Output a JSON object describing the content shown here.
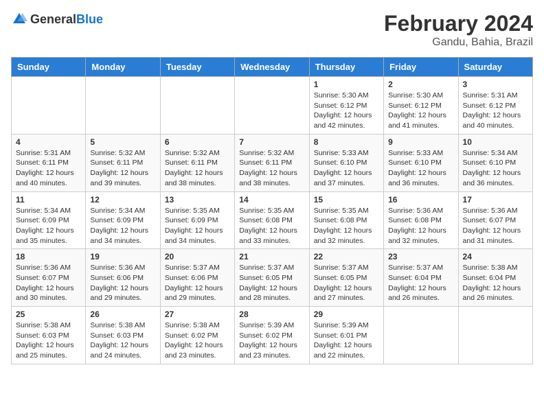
{
  "header": {
    "logo_general": "General",
    "logo_blue": "Blue",
    "title": "February 2024",
    "location": "Gandu, Bahia, Brazil"
  },
  "weekdays": [
    "Sunday",
    "Monday",
    "Tuesday",
    "Wednesday",
    "Thursday",
    "Friday",
    "Saturday"
  ],
  "weeks": [
    [
      {
        "day": "",
        "info": ""
      },
      {
        "day": "",
        "info": ""
      },
      {
        "day": "",
        "info": ""
      },
      {
        "day": "",
        "info": ""
      },
      {
        "day": "1",
        "info": "Sunrise: 5:30 AM\nSunset: 6:12 PM\nDaylight: 12 hours\nand 42 minutes."
      },
      {
        "day": "2",
        "info": "Sunrise: 5:30 AM\nSunset: 6:12 PM\nDaylight: 12 hours\nand 41 minutes."
      },
      {
        "day": "3",
        "info": "Sunrise: 5:31 AM\nSunset: 6:12 PM\nDaylight: 12 hours\nand 40 minutes."
      }
    ],
    [
      {
        "day": "4",
        "info": "Sunrise: 5:31 AM\nSunset: 6:11 PM\nDaylight: 12 hours\nand 40 minutes."
      },
      {
        "day": "5",
        "info": "Sunrise: 5:32 AM\nSunset: 6:11 PM\nDaylight: 12 hours\nand 39 minutes."
      },
      {
        "day": "6",
        "info": "Sunrise: 5:32 AM\nSunset: 6:11 PM\nDaylight: 12 hours\nand 38 minutes."
      },
      {
        "day": "7",
        "info": "Sunrise: 5:32 AM\nSunset: 6:11 PM\nDaylight: 12 hours\nand 38 minutes."
      },
      {
        "day": "8",
        "info": "Sunrise: 5:33 AM\nSunset: 6:10 PM\nDaylight: 12 hours\nand 37 minutes."
      },
      {
        "day": "9",
        "info": "Sunrise: 5:33 AM\nSunset: 6:10 PM\nDaylight: 12 hours\nand 36 minutes."
      },
      {
        "day": "10",
        "info": "Sunrise: 5:34 AM\nSunset: 6:10 PM\nDaylight: 12 hours\nand 36 minutes."
      }
    ],
    [
      {
        "day": "11",
        "info": "Sunrise: 5:34 AM\nSunset: 6:09 PM\nDaylight: 12 hours\nand 35 minutes."
      },
      {
        "day": "12",
        "info": "Sunrise: 5:34 AM\nSunset: 6:09 PM\nDaylight: 12 hours\nand 34 minutes."
      },
      {
        "day": "13",
        "info": "Sunrise: 5:35 AM\nSunset: 6:09 PM\nDaylight: 12 hours\nand 34 minutes."
      },
      {
        "day": "14",
        "info": "Sunrise: 5:35 AM\nSunset: 6:08 PM\nDaylight: 12 hours\nand 33 minutes."
      },
      {
        "day": "15",
        "info": "Sunrise: 5:35 AM\nSunset: 6:08 PM\nDaylight: 12 hours\nand 32 minutes."
      },
      {
        "day": "16",
        "info": "Sunrise: 5:36 AM\nSunset: 6:08 PM\nDaylight: 12 hours\nand 32 minutes."
      },
      {
        "day": "17",
        "info": "Sunrise: 5:36 AM\nSunset: 6:07 PM\nDaylight: 12 hours\nand 31 minutes."
      }
    ],
    [
      {
        "day": "18",
        "info": "Sunrise: 5:36 AM\nSunset: 6:07 PM\nDaylight: 12 hours\nand 30 minutes."
      },
      {
        "day": "19",
        "info": "Sunrise: 5:36 AM\nSunset: 6:06 PM\nDaylight: 12 hours\nand 29 minutes."
      },
      {
        "day": "20",
        "info": "Sunrise: 5:37 AM\nSunset: 6:06 PM\nDaylight: 12 hours\nand 29 minutes."
      },
      {
        "day": "21",
        "info": "Sunrise: 5:37 AM\nSunset: 6:05 PM\nDaylight: 12 hours\nand 28 minutes."
      },
      {
        "day": "22",
        "info": "Sunrise: 5:37 AM\nSunset: 6:05 PM\nDaylight: 12 hours\nand 27 minutes."
      },
      {
        "day": "23",
        "info": "Sunrise: 5:37 AM\nSunset: 6:04 PM\nDaylight: 12 hours\nand 26 minutes."
      },
      {
        "day": "24",
        "info": "Sunrise: 5:38 AM\nSunset: 6:04 PM\nDaylight: 12 hours\nand 26 minutes."
      }
    ],
    [
      {
        "day": "25",
        "info": "Sunrise: 5:38 AM\nSunset: 6:03 PM\nDaylight: 12 hours\nand 25 minutes."
      },
      {
        "day": "26",
        "info": "Sunrise: 5:38 AM\nSunset: 6:03 PM\nDaylight: 12 hours\nand 24 minutes."
      },
      {
        "day": "27",
        "info": "Sunrise: 5:38 AM\nSunset: 6:02 PM\nDaylight: 12 hours\nand 23 minutes."
      },
      {
        "day": "28",
        "info": "Sunrise: 5:39 AM\nSunset: 6:02 PM\nDaylight: 12 hours\nand 23 minutes."
      },
      {
        "day": "29",
        "info": "Sunrise: 5:39 AM\nSunset: 6:01 PM\nDaylight: 12 hours\nand 22 minutes."
      },
      {
        "day": "",
        "info": ""
      },
      {
        "day": "",
        "info": ""
      }
    ]
  ]
}
